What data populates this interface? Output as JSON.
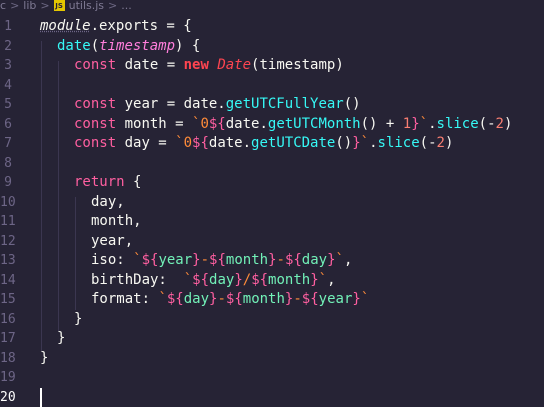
{
  "breadcrumb": {
    "part1": "c",
    "part2": "lib",
    "file": "utils.js",
    "more": "..."
  },
  "line_numbers": [
    "1",
    "2",
    "3",
    "4",
    "5",
    "6",
    "7",
    "8",
    "9",
    "10",
    "11",
    "12",
    "13",
    "14",
    "15",
    "16",
    "17",
    "18",
    "19",
    "20"
  ],
  "active_line": "20",
  "code": {
    "l1": [
      "module",
      ".exports = {"
    ],
    "l2": [
      "date",
      "(",
      "timestamp",
      ") {"
    ],
    "l3": [
      "const",
      " date = ",
      "new",
      " ",
      "Date",
      "(timestamp)"
    ],
    "l5": [
      "const",
      " year = date.",
      "getUTCFullYear",
      "()"
    ],
    "l6": [
      "const",
      " month = ",
      "`0",
      "${",
      "date.",
      "getUTCMonth",
      "() + ",
      "1",
      "}",
      "`",
      ".",
      "slice",
      "(-",
      "2",
      ")"
    ],
    "l7": [
      "const",
      " day = ",
      "`0",
      "${",
      "date.",
      "getUTCDate",
      "()",
      "}",
      "`",
      ".",
      "slice",
      "(-",
      "2",
      ")"
    ],
    "l9": [
      "return",
      " {"
    ],
    "l10": "day,",
    "l11": "month,",
    "l12": "year,",
    "l13": [
      "iso: ",
      "`",
      "${",
      "year",
      "}",
      "-",
      "${",
      "month",
      "}",
      "-",
      "${",
      "day",
      "}",
      "`",
      ","
    ],
    "l14": [
      "birthDay:  ",
      "`",
      "${",
      "day",
      "}",
      "/",
      "${",
      "month",
      "}",
      "`",
      ","
    ],
    "l15": [
      "format: ",
      "`",
      "${",
      "day",
      "}",
      "-",
      "${",
      "month",
      "}",
      "-",
      "${",
      "year",
      "}",
      "`"
    ],
    "l16": "}",
    "l17": "}",
    "l18": "}"
  }
}
